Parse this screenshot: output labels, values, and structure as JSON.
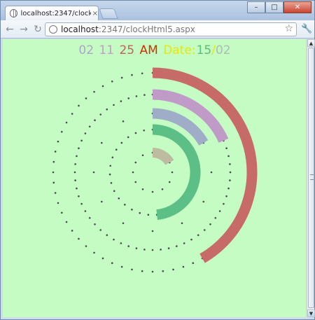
{
  "browser": {
    "tab_title": "localhost:2347/clockHtml5.",
    "tab_close": "×",
    "url_host": "localhost",
    "url_rest": ":2347/clockHtml5.aspx",
    "back": "←",
    "forward": "→",
    "reload": "↻",
    "star": "☆",
    "wrench": "🔧",
    "minimize": "–",
    "maximize": "□",
    "close": "✕"
  },
  "clock": {
    "hours": "02",
    "minutes": "11",
    "seconds": "25",
    "ampm": "AM",
    "date_label": "Date:",
    "day": "15",
    "separator": "/",
    "month": "02",
    "colors": {
      "background": "#c4fcc4",
      "hours": "#a9a6c9",
      "minutes": "#c59bbf",
      "seconds": "#c0605c",
      "ampm": "#cc3300",
      "date_label": "#e8e800",
      "day": "#58c07c",
      "separator": "#e8e800",
      "month": "#a9bfb0",
      "dots": "#4a4a4a"
    },
    "rings": [
      {
        "name": "seconds-ring",
        "value": 25,
        "max": 60,
        "color": "#c76b69"
      },
      {
        "name": "minutes-ring",
        "value": 11,
        "max": 60,
        "color": "#c09bc8"
      },
      {
        "name": "hours-ring",
        "value": 2,
        "max": 12,
        "color": "#9fadc8"
      },
      {
        "name": "day-ring",
        "value": 15,
        "max": 31,
        "color": "#5cbf86"
      },
      {
        "name": "month-ring",
        "value": 2,
        "max": 12,
        "color": "#bdbba0"
      }
    ]
  }
}
